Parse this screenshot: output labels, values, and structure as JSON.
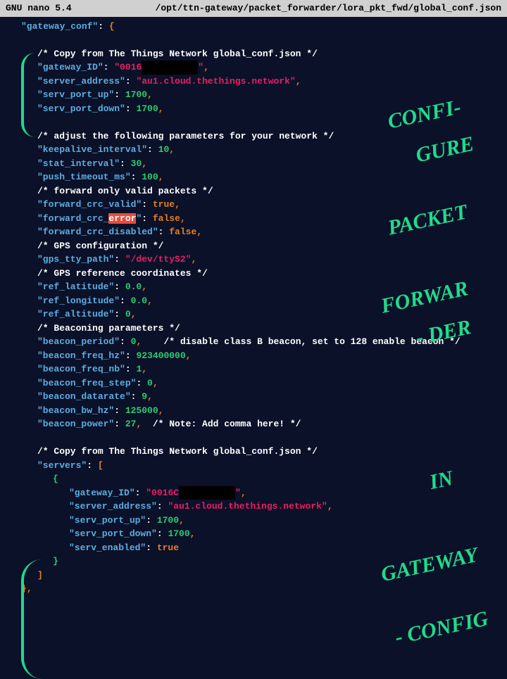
{
  "titlebar": {
    "left": "GNU nano 5.4",
    "right": "/opt/ttn-gateway/packet_forwarder/lora_pkt_fwd/global_conf.json"
  },
  "code": {
    "gateway_conf_key": "\"gateway_conf\"",
    "comment1": "/* Copy from The Things Network global_conf.json */",
    "gateway_ID_key": "\"gateway_ID\"",
    "gateway_ID_val": "\"0016",
    "gateway_ID_end": "\"",
    "server_address_key": "\"server_address\"",
    "server_address_val": "\"au1.cloud.thethings.network\"",
    "serv_port_up_key": "\"serv_port_up\"",
    "serv_port_up_val": "1700",
    "serv_port_down_key": "\"serv_port_down\"",
    "serv_port_down_val": "1700",
    "comment2": "/* adjust the following parameters for your network */",
    "keepalive_key": "\"keepalive_interval\"",
    "keepalive_val": "10",
    "stat_interval_key": "\"stat_interval\"",
    "stat_interval_val": "30",
    "push_timeout_key": "\"push_timeout_ms\"",
    "push_timeout_val": "100",
    "comment3": "/* forward only valid packets */",
    "crc_valid_key": "\"forward_crc_valid\"",
    "crc_valid_val": "true",
    "crc_error_pre": "\"forward_crc_",
    "crc_error_hl": "error",
    "crc_error_post": "\"",
    "crc_error_val": "false",
    "crc_disabled_key": "\"forward_crc_disabled\"",
    "crc_disabled_val": "false",
    "comment4": "/* GPS configuration */",
    "gps_tty_key": "\"gps_tty_path\"",
    "gps_tty_val": "\"/dev/ttyS2\"",
    "comment5": "/* GPS reference coordinates */",
    "ref_lat_key": "\"ref_latitude\"",
    "ref_lat_val": "0.0",
    "ref_lon_key": "\"ref_longitude\"",
    "ref_lon_val": "0.0",
    "ref_alt_key": "\"ref_altitude\"",
    "ref_alt_val": "0",
    "comment6": "/* Beaconing parameters */",
    "beacon_period_key": "\"beacon_period\"",
    "beacon_period_val": "0",
    "beacon_period_cmt": "/* disable class B beacon, set to 128 enable beacon */",
    "beacon_freq_hz_key": "\"beacon_freq_hz\"",
    "beacon_freq_hz_val": "923400000",
    "beacon_freq_nb_key": "\"beacon_freq_nb\"",
    "beacon_freq_nb_val": "1",
    "beacon_freq_step_key": "\"beacon_freq_step\"",
    "beacon_freq_step_val": "0",
    "beacon_datarate_key": "\"beacon_datarate\"",
    "beacon_datarate_val": "9",
    "beacon_bw_hz_key": "\"beacon_bw_hz\"",
    "beacon_bw_hz_val": "125000",
    "beacon_power_key": "\"beacon_power\"",
    "beacon_power_val": "27",
    "beacon_power_cmt": "/* Note: Add comma here! */",
    "comment7": "/* Copy from The Things Network global_conf.json */",
    "servers_key": "\"servers\"",
    "srv_gateway_ID_key": "\"gateway_ID\"",
    "srv_gateway_ID_val": "\"0016C",
    "srv_gateway_ID_end": "\"",
    "srv_server_address_key": "\"server_address\"",
    "srv_server_address_val": "\"au1.cloud.thethings.network\"",
    "srv_port_up_key": "\"serv_port_up\"",
    "srv_port_up_val": "1700",
    "srv_port_down_key": "\"serv_port_down\"",
    "srv_port_down_val": "1700",
    "srv_enabled_key": "\"serv_enabled\"",
    "srv_enabled_val": "true"
  },
  "annotations": {
    "a1": "CONFI-",
    "a2": "GURE",
    "a3": "PACKET",
    "a4": "FORWAR",
    "a5": "- DER",
    "a6": "IN",
    "a7": "GATEWAY",
    "a8": "- CONFIG"
  }
}
